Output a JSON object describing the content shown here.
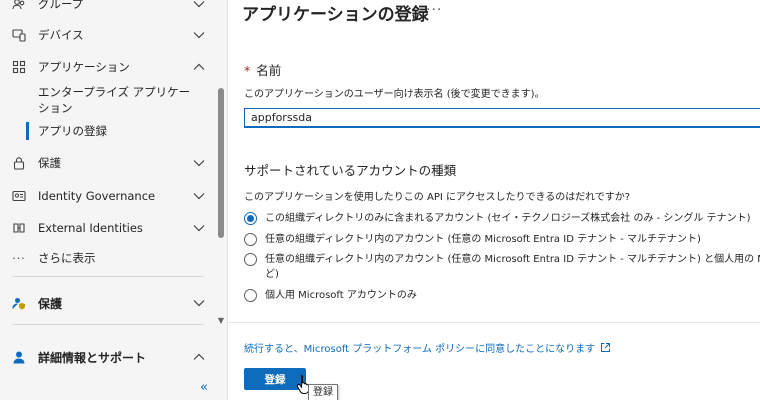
{
  "sidebar": {
    "items": [
      {
        "label": "グループ",
        "icon": "group-icon",
        "expanded": false
      },
      {
        "label": "デバイス",
        "icon": "devices-icon",
        "expanded": false
      },
      {
        "label": "アプリケーション",
        "icon": "applications-icon",
        "expanded": true
      },
      {
        "label": "保護",
        "icon": "lock-icon",
        "expanded": false
      },
      {
        "label": "Identity Governance",
        "icon": "identity-governance-icon",
        "expanded": false
      },
      {
        "label": "External Identities",
        "icon": "external-identities-icon",
        "expanded": false
      },
      {
        "label": "さらに表示",
        "icon": "more-icon"
      }
    ],
    "sub_items": [
      {
        "label_line1": "エンタープライズ アプリケー",
        "label_line2": "ション"
      },
      {
        "label": "アプリの登録",
        "selected": true
      }
    ],
    "sections": [
      {
        "label": "保護",
        "icon": "protection-icon",
        "expanded": false
      },
      {
        "label": "詳細情報とサポート",
        "icon": "support-icon",
        "expanded": true
      }
    ],
    "collapse_glyph": "«"
  },
  "main": {
    "title": "アプリケーションの登録",
    "more_glyph": "···",
    "name_field": {
      "required_mark": "*",
      "label": "名前",
      "description": "このアプリケーションのユーザー向け表示名 (後で変更できます)。",
      "value": "appforssda"
    },
    "account_types": {
      "title": "サポートされているアカウントの種類",
      "question": "このアプリケーションを使用したりこの API にアクセスしたりできるのはだれですか?",
      "options": [
        {
          "label": "この組織ディレクトリのみに含まれるアカウント (セイ・テクノロジーズ株式会社 のみ - シングル テナント)",
          "checked": true
        },
        {
          "label": "任意の組織ディレクトリ内のアカウント (任意の Microsoft Entra ID テナント - マルチテナント)",
          "checked": false
        },
        {
          "label": "任意の組織ディレクトリ内のアカウント (任意の Microsoft Entra ID テナント - マルチテナント) と個人用の Microsoft ア",
          "label_cont": "ど)",
          "checked": false
        },
        {
          "label": "個人用 Microsoft アカウントのみ",
          "checked": false
        }
      ]
    },
    "policy_text": "続行すると、Microsoft プラットフォーム ポリシーに同意したことになります",
    "register_button": "登録",
    "tooltip": "登録"
  },
  "colors": {
    "accent": "#0f6cbd",
    "sidebar_bg": "#f5f5f5",
    "required": "#a4262c"
  }
}
